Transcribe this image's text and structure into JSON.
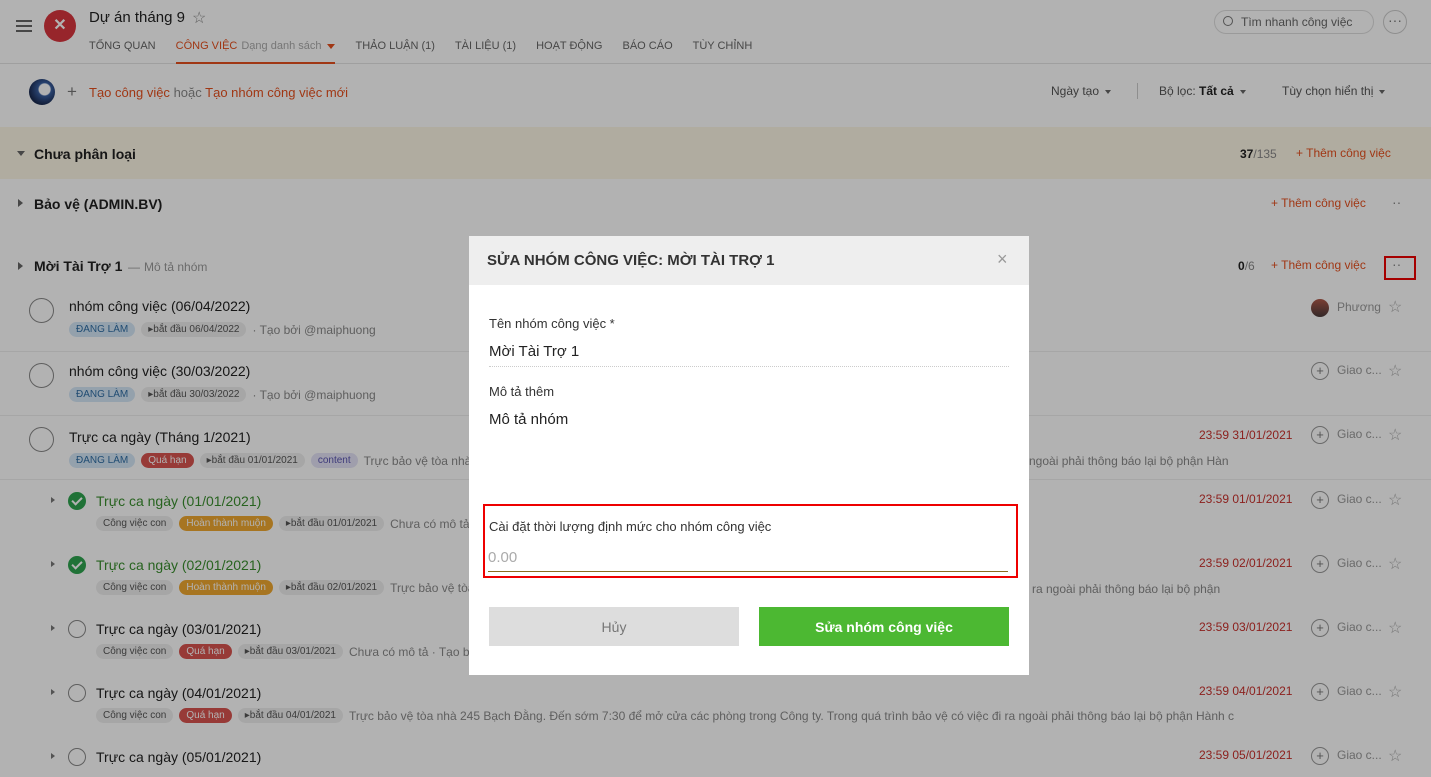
{
  "header": {
    "title": "Dự án tháng 9",
    "logo_text": "✕",
    "tabs": [
      {
        "label": "TỔNG QUAN"
      },
      {
        "label": "CÔNG VIỆC",
        "sub": "Dạng danh sách"
      },
      {
        "label": "THẢO LUẬN (1)"
      },
      {
        "label": "TÀI LIỆU (1)"
      },
      {
        "label": "HOẠT ĐỘNG"
      },
      {
        "label": "BÁO CÁO"
      },
      {
        "label": "TÙY CHỈNH"
      }
    ],
    "search_placeholder": "Tìm nhanh công việc",
    "more": "···"
  },
  "toolbar": {
    "create_task": "Tạo công việc",
    "or": "hoặc",
    "create_group": "Tạo nhóm công việc mới",
    "sort_label": "Ngày tạo",
    "filter_label": "Bộ lọc:",
    "filter_value": "Tất cả",
    "display_label": "Tùy chọn hiển thị"
  },
  "groups": [
    {
      "name": "Chưa phân loại",
      "count_done": "37",
      "count_total": "/135",
      "add": "Thêm công việc"
    },
    {
      "name": "Bảo vệ (ADMIN.BV)",
      "add": "Thêm công việc",
      "more": "··"
    },
    {
      "name": "Mời Tài Trợ 1",
      "dash": "—",
      "desc": "Mô tả nhóm",
      "count_done": "0",
      "count_total": "/6",
      "add": "Thêm công việc",
      "more": "··"
    }
  ],
  "tasks": [
    {
      "title": "nhóm công việc (06/04/2022)",
      "status": "ĐANG LÀM",
      "start": "bắt đầu 06/04/2022",
      "meta": "· Tạo bởi @maiphuong",
      "assignee": "Phương"
    },
    {
      "title": "nhóm công việc (30/03/2022)",
      "status": "ĐANG LÀM",
      "start": "bắt đầu 30/03/2022",
      "meta": "· Tạo bởi @maiphuong",
      "assignee": "Giao c..."
    },
    {
      "title": "Trực ca ngày (Tháng 1/2021)",
      "status": "ĐANG LÀM",
      "overdue": "Quá hạn",
      "start": "bắt đầu 01/01/2021",
      "label": "content",
      "meta": "Trực bảo vệ tòa nhà",
      "meta_right": "ngoài phải thông báo lại bộ phận Hàn",
      "due": "23:59 31/01/2021",
      "assignee": "Giao c..."
    },
    {
      "title": "Trực ca ngày (01/01/2021)",
      "type": "Công việc con",
      "done_late": "Hoàn thành muộn",
      "start": "bắt đầu 01/01/2021",
      "meta": "Chưa có mô tả",
      "due": "23:59 01/01/2021",
      "assignee": "Giao c..."
    },
    {
      "title": "Trực ca ngày (02/01/2021)",
      "type": "Công việc con",
      "done_late": "Hoàn thành muộn",
      "start": "bắt đầu 02/01/2021",
      "meta": "Trực bảo vệ tòa",
      "meta_right": "ra ngoài phải thông báo lại bộ phận",
      "due": "23:59 02/01/2021",
      "assignee": "Giao c..."
    },
    {
      "title": "Trực ca ngày (03/01/2021)",
      "type": "Công việc con",
      "overdue": "Quá hạn",
      "start": "bắt đầu 03/01/2021",
      "meta": "Chưa có mô tả · Tạo bở",
      "due": "23:59 03/01/2021",
      "assignee": "Giao c..."
    },
    {
      "title": "Trực ca ngày (04/01/2021)",
      "type": "Công việc con",
      "overdue": "Quá hạn",
      "start": "bắt đầu 04/01/2021",
      "meta": "Trực bảo vệ tòa nhà 245 Bạch Đằng. Đến sớm 7:30 để mở cửa các phòng trong Công ty. Trong quá trình bảo vệ có việc đi ra ngoài phải thông báo lại bộ phận Hành c",
      "due": "23:59 04/01/2021",
      "assignee": "Giao c..."
    },
    {
      "title": "Trực ca ngày (05/01/2021)",
      "due": "23:59 05/01/2021",
      "assignee": "Giao c..."
    }
  ],
  "modal": {
    "title": "SỬA NHÓM CÔNG VIỆC: MỜI TÀI TRỢ 1",
    "close": "×",
    "name_label": "Tên nhóm công việc *",
    "name_value": "Mời Tài Trợ 1",
    "desc_label": "Mô tả thêm",
    "desc_value": "Mô tả nhóm",
    "duration_label": "Cài đặt thời lượng định mức cho nhóm công việc",
    "duration_placeholder": "0.00",
    "cancel": "Hủy",
    "submit": "Sửa nhóm công việc"
  }
}
